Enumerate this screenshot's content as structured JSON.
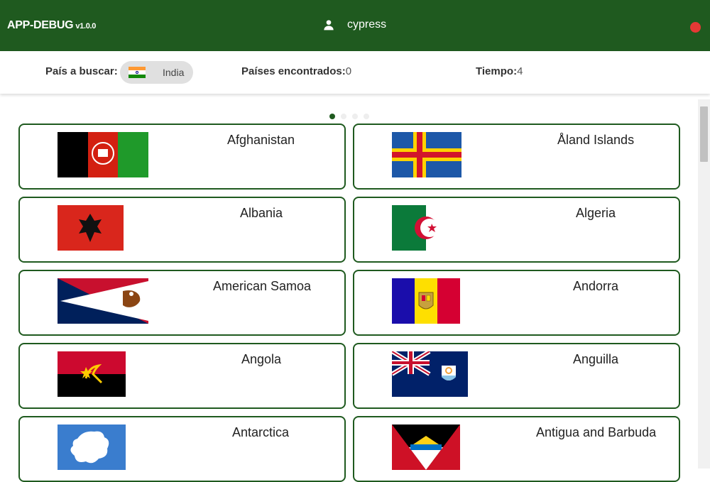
{
  "header": {
    "app_name": "APP-DEBUG",
    "version": "v1.0.0",
    "username": "cypress",
    "status_color": "#e53935"
  },
  "search": {
    "label": "País a buscar:",
    "selected_country": "India",
    "found_label": "Países encontrados:",
    "found_count": "0",
    "time_label": "Tiempo:",
    "time_value": "4"
  },
  "pagination": {
    "pages": 4,
    "active": 1
  },
  "countries": [
    {
      "name": "Afghanistan",
      "flag": "afghanistan-flag"
    },
    {
      "name": "Åland Islands",
      "flag": "aland-flag"
    },
    {
      "name": "Albania",
      "flag": "albania-flag"
    },
    {
      "name": "Algeria",
      "flag": "algeria-flag"
    },
    {
      "name": "American Samoa",
      "flag": "american-samoa-flag"
    },
    {
      "name": "Andorra",
      "flag": "andorra-flag"
    },
    {
      "name": "Angola",
      "flag": "angola-flag"
    },
    {
      "name": "Anguilla",
      "flag": "anguilla-flag"
    },
    {
      "name": "Antarctica",
      "flag": "antarctica-flag"
    },
    {
      "name": "Antigua and Barbuda",
      "flag": "antigua-flag"
    }
  ],
  "colors": {
    "primary": "#1f5a1f",
    "chip_bg": "#e0e0e0"
  }
}
